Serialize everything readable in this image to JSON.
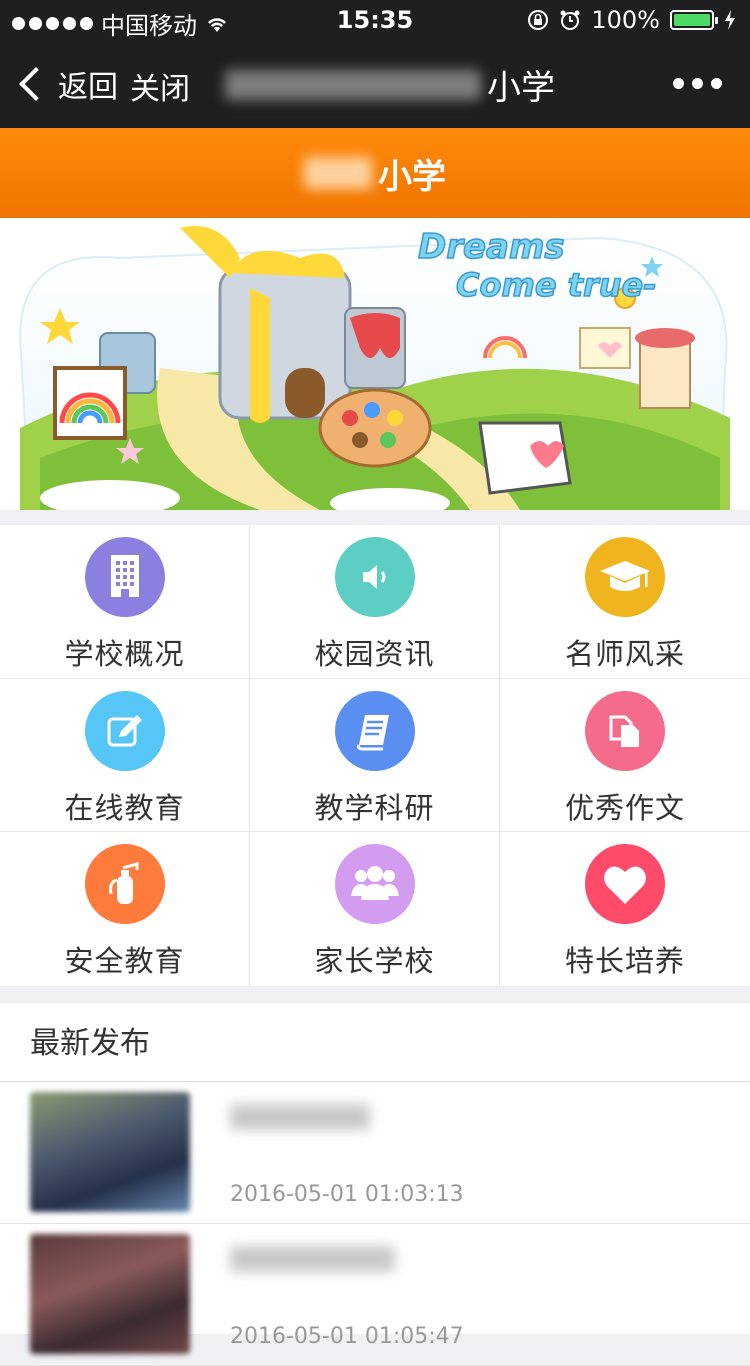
{
  "status_bar": {
    "carrier": "中国移动",
    "time": "15:35",
    "battery": "100%"
  },
  "nav": {
    "back_label": "返回",
    "close_label": "关闭",
    "title_suffix": "小学"
  },
  "header": {
    "title_suffix": "小学"
  },
  "banner": {
    "text_line1": "Dreams",
    "text_line2": "Come true-",
    "page_count": 2,
    "active_page": 2
  },
  "menu": [
    {
      "label": "学校概况",
      "icon": "building-icon",
      "color": "#8b7fe0"
    },
    {
      "label": "校园资讯",
      "icon": "speaker-icon",
      "color": "#5ccec3"
    },
    {
      "label": "名师风采",
      "icon": "graduation-cap-icon",
      "color": "#f0b51e"
    },
    {
      "label": "在线教育",
      "icon": "edit-icon",
      "color": "#55c6f5"
    },
    {
      "label": "教学科研",
      "icon": "book-icon",
      "color": "#5a8ef0"
    },
    {
      "label": "优秀作文",
      "icon": "copy-icon",
      "color": "#f56b8c"
    },
    {
      "label": "安全教育",
      "icon": "fire-extinguisher-icon",
      "color": "#ff7b3b"
    },
    {
      "label": "家长学校",
      "icon": "people-icon",
      "color": "#d49cf0"
    },
    {
      "label": "特长培养",
      "icon": "heart-icon",
      "color": "#ff4a6a"
    }
  ],
  "latest": {
    "title": "最新发布",
    "items": [
      {
        "time": "2016-05-01 01:03:13"
      },
      {
        "time": "2016-05-01 01:05:47"
      }
    ]
  }
}
